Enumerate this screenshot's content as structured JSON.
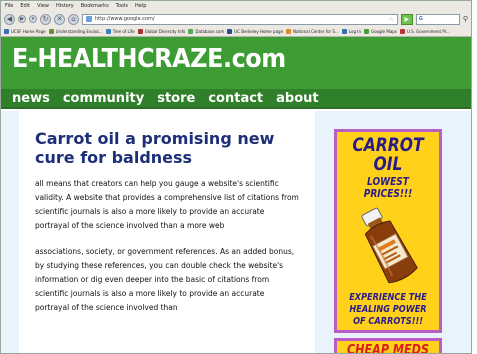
{
  "browser": {
    "menu": [
      "File",
      "Edit",
      "View",
      "History",
      "Bookmarks",
      "Tools",
      "Help"
    ],
    "url": "http://www.google.com/",
    "search_placeholder": "",
    "bookmarks": [
      {
        "label": "UCSF Home Page",
        "color": "#3c6fb5"
      },
      {
        "label": "Understanding Evolut...",
        "color": "#6a8e3a"
      },
      {
        "label": "Tree of Life",
        "color": "#3b7ec2"
      },
      {
        "label": "Global Diversity Info",
        "color": "#a33"
      },
      {
        "label": "Database.com",
        "color": "#5a5"
      },
      {
        "label": "UC Berkeley Home page",
        "color": "#2b4f8a"
      },
      {
        "label": "National Center for S...",
        "color": "#e08b2c"
      },
      {
        "label": "Log In",
        "color": "#3a6cb0"
      },
      {
        "label": "Google Maps",
        "color": "#4a9c3a"
      },
      {
        "label": "U.S. Government Pr...",
        "color": "#b33"
      }
    ]
  },
  "site": {
    "logo": "E-HEALTHCRAZE.com",
    "nav": [
      "news",
      "community",
      "store",
      "contact",
      "about"
    ]
  },
  "article": {
    "title": "Carrot oil a promising new cure for baldness",
    "paragraphs": [
      "all means that creators can help you gauge a website's scientific validity. A website that provides a comprehensive list of citations from scientific journals is also a more likely to provide an accurate portrayal of the science involved than a more web",
      "associations, society, or government references. As an added bonus, by studying these references, you can double check the website's information or dig even deeper into the basic of citations from scientific journals is also a more likely to provide an accurate portrayal of the science involved than"
    ]
  },
  "ads": {
    "main": {
      "headline": "CARROT OIL",
      "tagline": "LOWEST PRICES!!!",
      "slogan": "EXPERIENCE THE HEALING POWER OF CARROTS!!!"
    },
    "secondary": {
      "headline": "CHEAP MEDS"
    }
  },
  "colors": {
    "header_green": "#3e9c35",
    "nav_green": "#307f2a",
    "title_blue": "#1d2f78",
    "ad_yellow": "#ffd11a",
    "ad_border": "#b95ec4",
    "ad_text": "#2a1a8a",
    "ad_red": "#d81e1e"
  }
}
